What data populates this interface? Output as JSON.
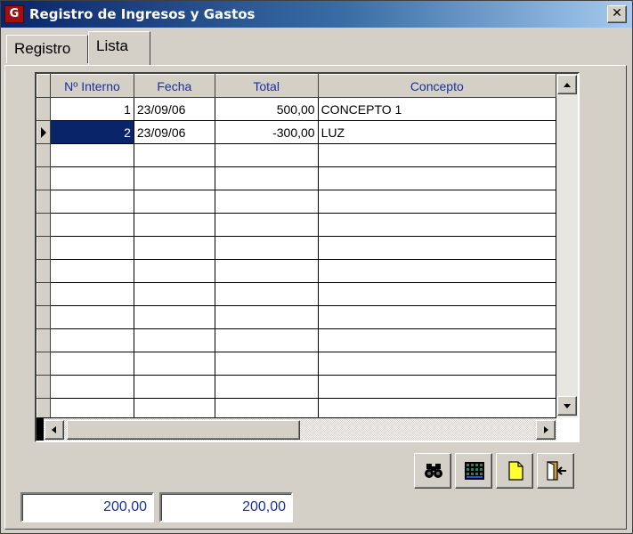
{
  "window": {
    "title": "Registro de Ingresos y Gastos",
    "app_icon_letter": "G",
    "close_glyph": "✕"
  },
  "tabs": [
    {
      "label": "Registro",
      "active": false
    },
    {
      "label": "Lista",
      "active": true
    }
  ],
  "grid": {
    "columns": [
      "Nº Interno",
      "Fecha",
      "Total",
      "Concepto"
    ],
    "rows": [
      {
        "interno": "1",
        "fecha": "23/09/06",
        "total": "500,00",
        "concepto": "CONCEPTO 1"
      },
      {
        "interno": "2",
        "fecha": "23/09/06",
        "total": "-300,00",
        "concepto": "LUZ",
        "selected": true
      }
    ],
    "empty_rows": 12
  },
  "toolbar": {
    "buttons": [
      {
        "name": "search-button",
        "icon": "binoculars-icon"
      },
      {
        "name": "grid-button",
        "icon": "grid-icon"
      },
      {
        "name": "new-document-button",
        "icon": "new-document-icon"
      },
      {
        "name": "exit-button",
        "icon": "exit-door-icon"
      }
    ]
  },
  "totals": {
    "field1": "200,00",
    "field2": "200,00"
  },
  "colors": {
    "titlebar_start": "#0a246a",
    "header_text": "#1a2fa0",
    "selection": "#0a246a",
    "face": "#d4d0c8"
  }
}
